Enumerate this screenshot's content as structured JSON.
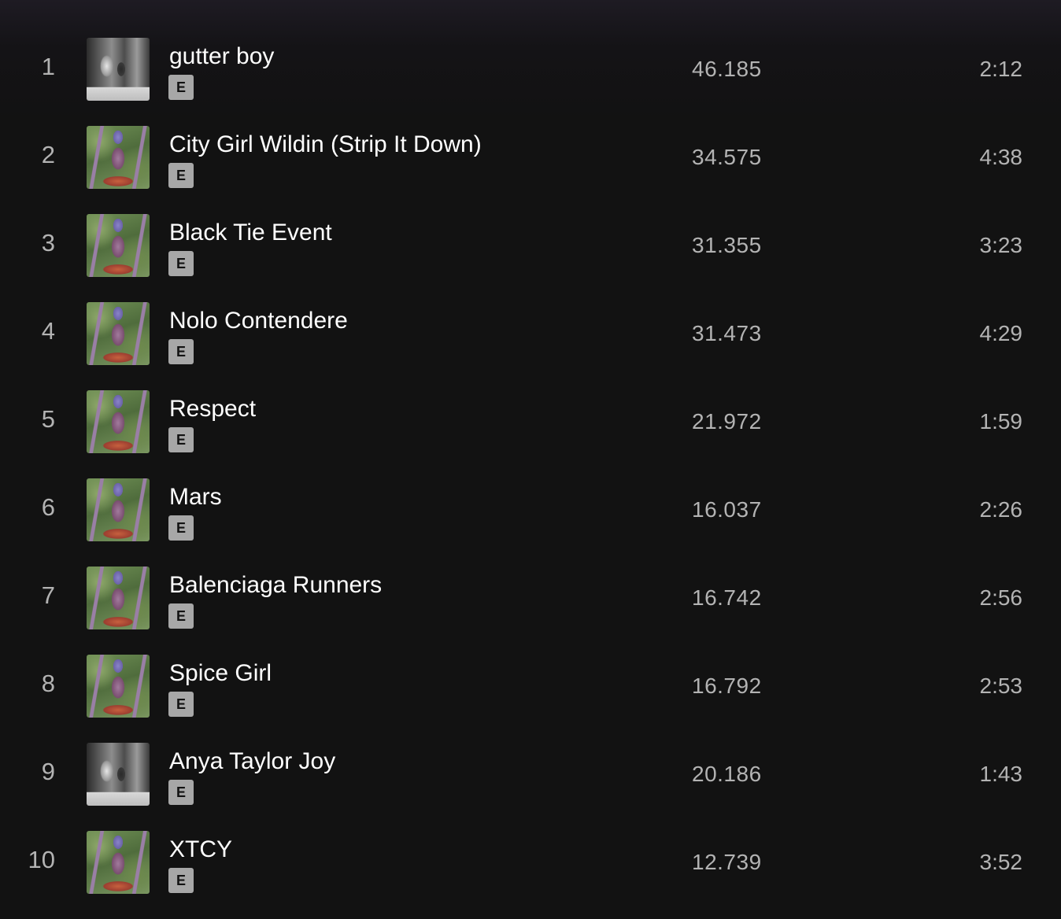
{
  "tracks": [
    {
      "number": "1",
      "title": "gutter boy",
      "explicit": "E",
      "plays": "46.185",
      "duration": "2:12",
      "cover": "cover-gray"
    },
    {
      "number": "2",
      "title": "City Girl Wildin (Strip It Down)",
      "explicit": "E",
      "plays": "34.575",
      "duration": "4:38",
      "cover": "cover-green"
    },
    {
      "number": "3",
      "title": "Black Tie Event",
      "explicit": "E",
      "plays": "31.355",
      "duration": "3:23",
      "cover": "cover-green"
    },
    {
      "number": "4",
      "title": "Nolo Contendere",
      "explicit": "E",
      "plays": "31.473",
      "duration": "4:29",
      "cover": "cover-green"
    },
    {
      "number": "5",
      "title": "Respect",
      "explicit": "E",
      "plays": "21.972",
      "duration": "1:59",
      "cover": "cover-green"
    },
    {
      "number": "6",
      "title": "Mars",
      "explicit": "E",
      "plays": "16.037",
      "duration": "2:26",
      "cover": "cover-green"
    },
    {
      "number": "7",
      "title": "Balenciaga Runners",
      "explicit": "E",
      "plays": "16.742",
      "duration": "2:56",
      "cover": "cover-green"
    },
    {
      "number": "8",
      "title": "Spice Girl",
      "explicit": "E",
      "plays": "16.792",
      "duration": "2:53",
      "cover": "cover-green"
    },
    {
      "number": "9",
      "title": "Anya Taylor Joy",
      "explicit": "E",
      "plays": "20.186",
      "duration": "1:43",
      "cover": "cover-gray"
    },
    {
      "number": "10",
      "title": "XTCY",
      "explicit": "E",
      "plays": "12.739",
      "duration": "3:52",
      "cover": "cover-green"
    }
  ],
  "colors": {
    "background": "#121212",
    "text_primary": "#ffffff",
    "text_secondary": "#b3b3b3",
    "explicit_badge": "#a7a7a7"
  }
}
